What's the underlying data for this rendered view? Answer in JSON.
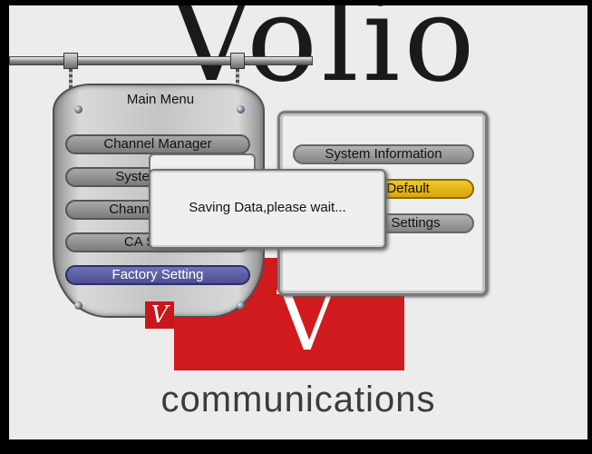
{
  "brand": {
    "script_text": "Volio",
    "logo_letter": "V",
    "wordmark": "communications",
    "colors": {
      "red": "#d11a1d",
      "dark": "#1a1a1a"
    }
  },
  "main_menu": {
    "title": "Main Menu",
    "items": [
      {
        "label": "Channel Manager",
        "selected": false
      },
      {
        "label": "System Setup",
        "selected": false
      },
      {
        "label": "Channel Search",
        "selected": false
      },
      {
        "label": "CA System",
        "selected": false
      },
      {
        "label": "Factory Setting",
        "selected": true
      }
    ],
    "icons": [
      "screw-icon",
      "v-logo-icon"
    ]
  },
  "sub_menu": {
    "items": [
      {
        "label": "System Information",
        "highlighted": false
      },
      {
        "label": "Factory Default",
        "highlighted": true
      },
      {
        "label": "Advanced Settings",
        "highlighted": false
      }
    ],
    "colors": {
      "highlight": "#e5b81c",
      "selected": "#5b5da5"
    }
  },
  "dialog": {
    "message": "Saving Data,please wait..."
  }
}
